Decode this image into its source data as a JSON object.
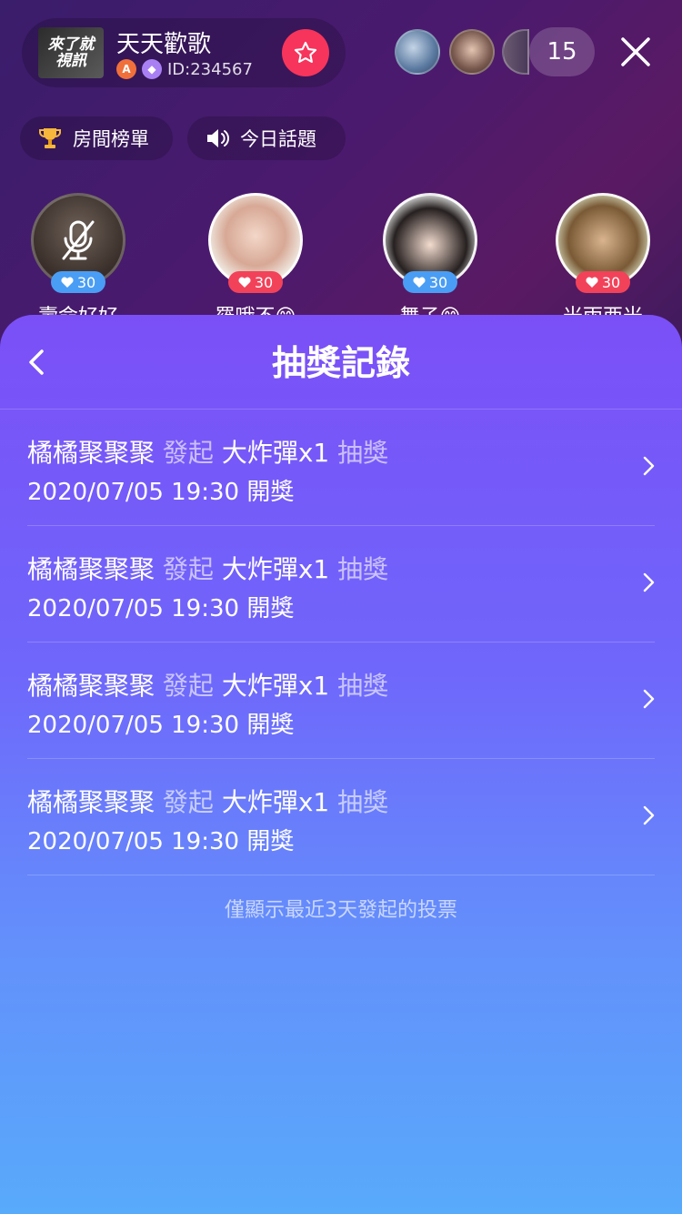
{
  "room": {
    "logo_text": "來了就 視訊",
    "title": "天天歡歌",
    "id_label": "ID:234567",
    "viewer_count": "15",
    "chips": {
      "rank": "房間榜單",
      "topic": "今日話題"
    }
  },
  "seats": [
    {
      "name": "壽命好好",
      "likes": "30",
      "heart_color": "#4a9df4",
      "muted": true
    },
    {
      "name": "羅哦不😊",
      "likes": "30",
      "heart_color": "#f2425a",
      "muted": false
    },
    {
      "name": "舞子😊",
      "likes": "30",
      "heart_color": "#4a9df4",
      "muted": false
    },
    {
      "name": "米雨西米",
      "likes": "30",
      "heart_color": "#f2425a",
      "muted": false
    }
  ],
  "panel": {
    "title": "抽獎記錄",
    "records": [
      {
        "user": "橘橘聚聚聚",
        "action": "發起",
        "prize": "大炸彈x1",
        "type": "抽獎",
        "time": "2020/07/05 19:30 開獎"
      },
      {
        "user": "橘橘聚聚聚",
        "action": "發起",
        "prize": "大炸彈x1",
        "type": "抽獎",
        "time": "2020/07/05 19:30 開獎"
      },
      {
        "user": "橘橘聚聚聚",
        "action": "發起",
        "prize": "大炸彈x1",
        "type": "抽獎",
        "time": "2020/07/05 19:30 開獎"
      },
      {
        "user": "橘橘聚聚聚",
        "action": "發起",
        "prize": "大炸彈x1",
        "type": "抽獎",
        "time": "2020/07/05 19:30 開獎"
      }
    ],
    "footer_note": "僅顯示最近3天發起的投票"
  },
  "colors": {
    "favorite": "#f7345b",
    "panel_top": "#7b4ff7",
    "panel_bottom": "#58aafb"
  },
  "icons": [
    "star-icon",
    "close-icon",
    "trophy-icon",
    "speaker-icon",
    "mic-off-icon",
    "heart-icon",
    "back-icon",
    "chevron-right-icon"
  ]
}
